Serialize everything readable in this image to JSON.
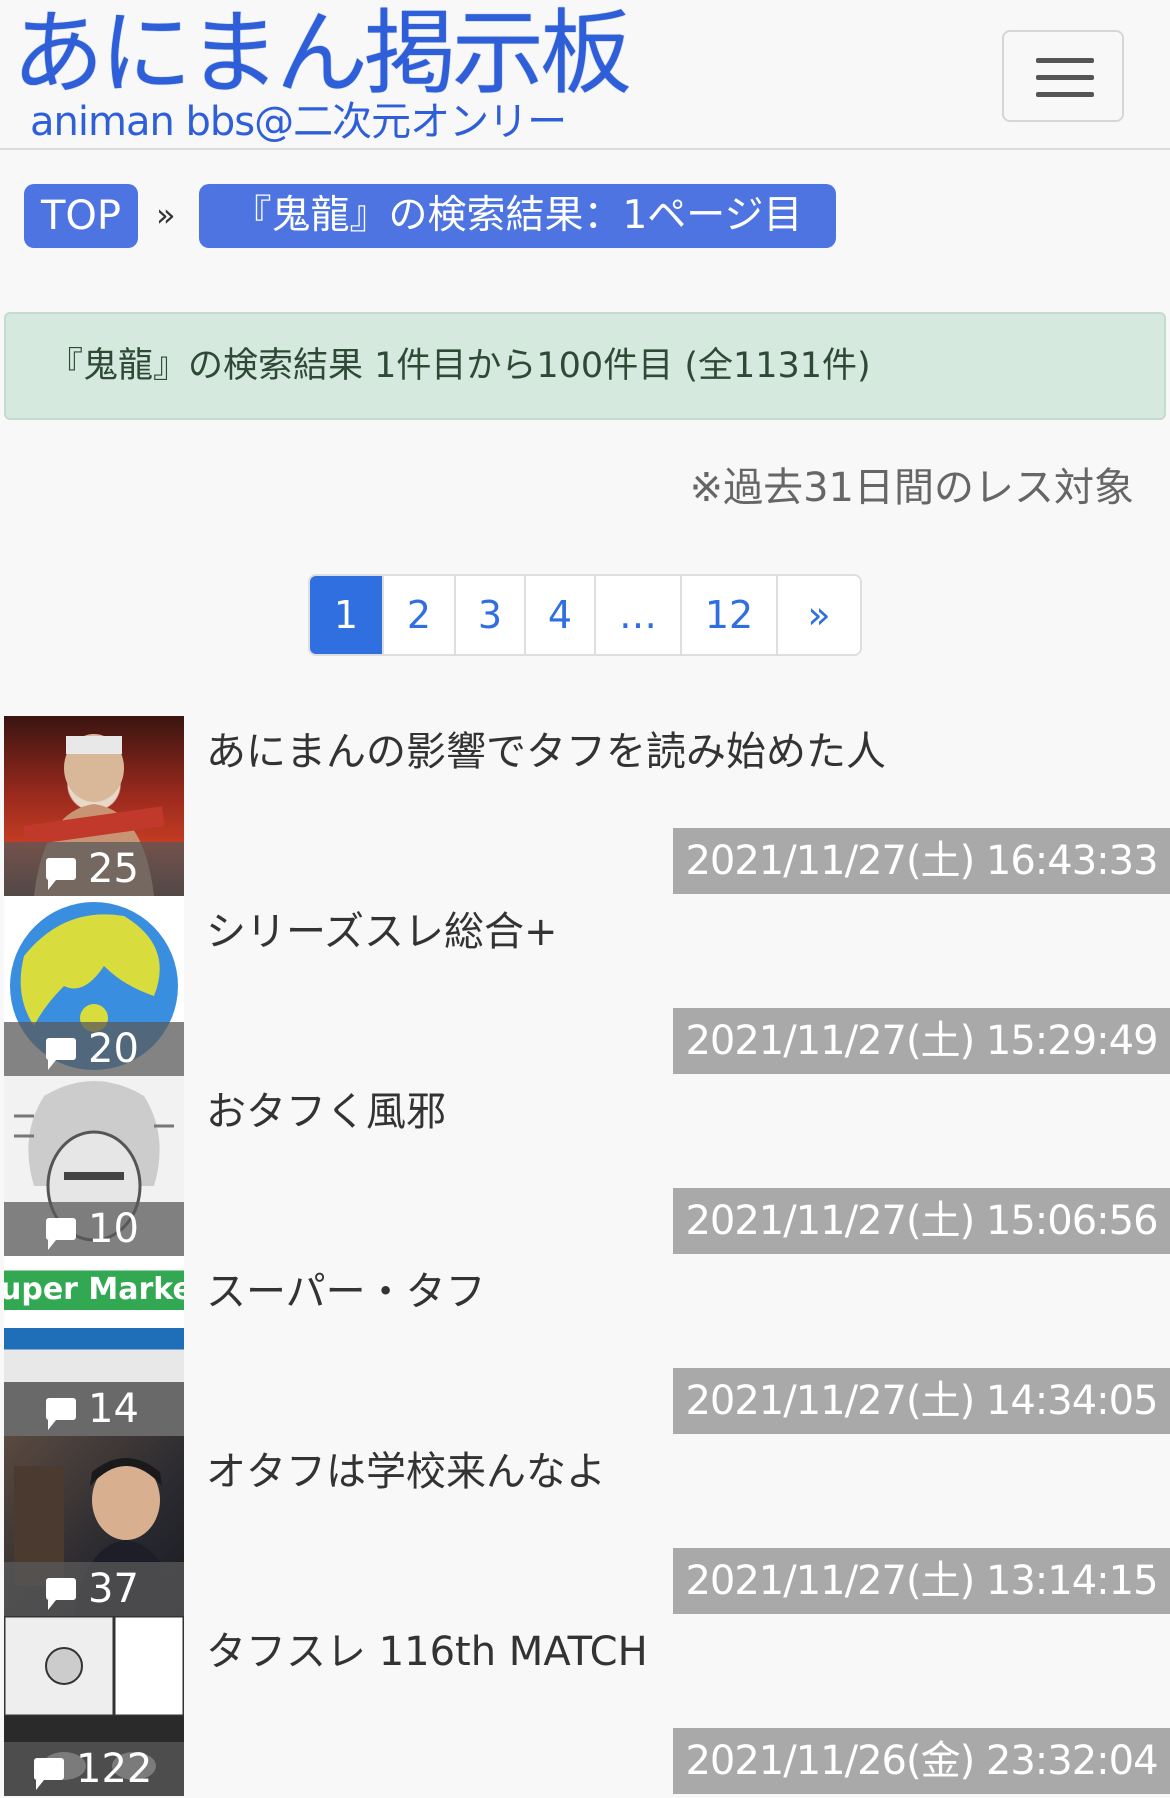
{
  "header": {
    "logo_main": "あにまん掲示板",
    "logo_sub": "animan bbs@二次元オンリー",
    "menu_icon": "hamburger-icon"
  },
  "breadcrumb": {
    "top": "TOP",
    "separator": "»",
    "current": "『鬼龍』の検索結果：1ページ目"
  },
  "result_summary": "『鬼龍』の検索結果 1件目から100件目 (全1131件)",
  "note": "※過去31日間のレス対象",
  "pagination": [
    "1",
    "2",
    "3",
    "4",
    "…",
    "12",
    "»"
  ],
  "pagination_active": "1",
  "threads": [
    {
      "title": "あにまんの影響でタフを読み始めた人",
      "count": "25",
      "date": "2021/11/27(土) 16:43:33"
    },
    {
      "title": "シリーズスレ総合+",
      "count": "20",
      "date": "2021/11/27(土) 15:29:49"
    },
    {
      "title": "おタフく風邪",
      "count": "10",
      "date": "2021/11/27(土) 15:06:56"
    },
    {
      "title": "スーパー・タフ",
      "count": "14",
      "date": "2021/11/27(土) 14:34:05",
      "thumb_text": "uper Marke"
    },
    {
      "title": "オタフは学校来んなよ",
      "count": "37",
      "date": "2021/11/27(土) 13:14:15"
    },
    {
      "title": "タフスレ 116th MATCH",
      "count": "122",
      "date": "2021/11/26(金) 23:32:04"
    }
  ],
  "colors": {
    "accent": "#4d74e0",
    "link": "#2f6fe0",
    "alert_bg": "#d6e9de",
    "date_bg": "#a9a9a9"
  }
}
